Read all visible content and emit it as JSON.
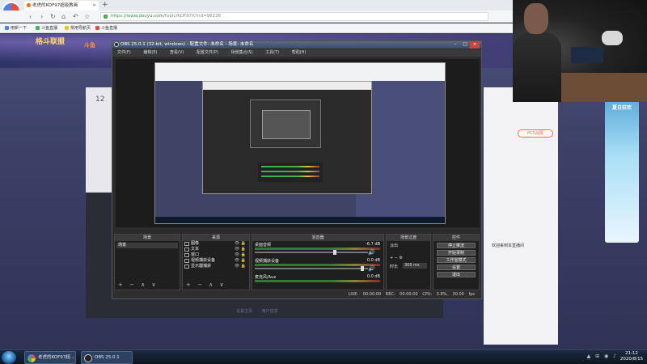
{
  "browser": {
    "badge": "立即领取",
    "tab_title": "老虎的KOF97超级教画",
    "tab_close": "×",
    "new_tab": "+",
    "address_host": "https://www.douyu.com",
    "address_path": "/topic/KOF97X?rid=96226",
    "bookmarks": [
      "用新一下",
      "斗鱼直播",
      "常用导航页",
      "斗鱼直播"
    ]
  },
  "page": {
    "game_logo": "格斗联盟",
    "douyu_tag": "斗鱼",
    "card_number": "12",
    "pcs_pill": "PCS战报",
    "chat_tip": "欢迎来到本直播间",
    "banner_ad": "夏日狂欢",
    "bottom_links": [
      "设置主页",
      "用户信息"
    ]
  },
  "obs": {
    "title": "OBS 25.0.1 (32-bit, windows) - 配置文件: 未命名 - 场景: 未命名",
    "menu": [
      "文件(F)",
      "编辑(E)",
      "查看(V)",
      "配置文件(P)",
      "场景集合(S)",
      "工具(T)",
      "帮助(H)"
    ],
    "docks": {
      "scenes": "场景",
      "sources": "来源",
      "mixer": "混音器",
      "transitions": "场景过渡",
      "controls": "控件"
    },
    "scene_selected": "场景",
    "sources": [
      {
        "name": "图像",
        "icons": "👁 🔒"
      },
      {
        "name": "文本",
        "icons": "👁 🔒"
      },
      {
        "name": "窗口",
        "icons": "👁 🔒"
      },
      {
        "name": "视频捕获设备",
        "icons": "👁 🔒"
      },
      {
        "name": "显示器捕获",
        "icons": "👁 🔒"
      }
    ],
    "mixer": [
      {
        "label": "桌面音频",
        "db": "-6.7 dB"
      },
      {
        "label": "视频捕获设备",
        "db": "0.0 dB"
      },
      {
        "label": "麦克风/Aux",
        "db": "0.0 dB"
      }
    ],
    "transition_type": "淡出",
    "transition_duration_label": "时长",
    "transition_duration": "300 ms",
    "controls": [
      "停止推流",
      "开始录制",
      "工作室模式",
      "设置",
      "退出"
    ],
    "status": "LIVE: 00:00:00  REC: 00:00:00  CPU: 3.8%, 30.00 fps",
    "dock_foot": "+ − ∧ ∨"
  },
  "taskbar": {
    "items": [
      "老虎的KOF97超...",
      "OBS 25.0.1 (32..."
    ],
    "tray": "▲ ⊞ ◉ ♪",
    "time": "21:12",
    "date": "2020/8/15"
  }
}
